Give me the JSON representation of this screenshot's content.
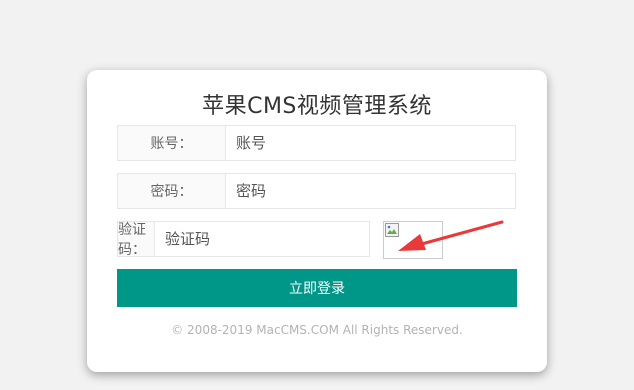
{
  "page": {
    "title": "苹果CMS视频管理系统"
  },
  "form": {
    "account": {
      "label": "账号：",
      "placeholder": "账号",
      "value": ""
    },
    "password": {
      "label": "密码：",
      "placeholder": "密码",
      "value": ""
    },
    "captcha": {
      "label": "验证码：",
      "placeholder": "验证码",
      "value": ""
    }
  },
  "captcha_image": {
    "icon": "broken-image-icon"
  },
  "login_button": {
    "label": "立即登录",
    "color": "#009688"
  },
  "footer": {
    "copyright": "© 2008-2019 MacCMS.COM All Rights Reserved."
  },
  "annotation": {
    "icon": "red-arrow-icon",
    "color": "#e83a3a"
  }
}
